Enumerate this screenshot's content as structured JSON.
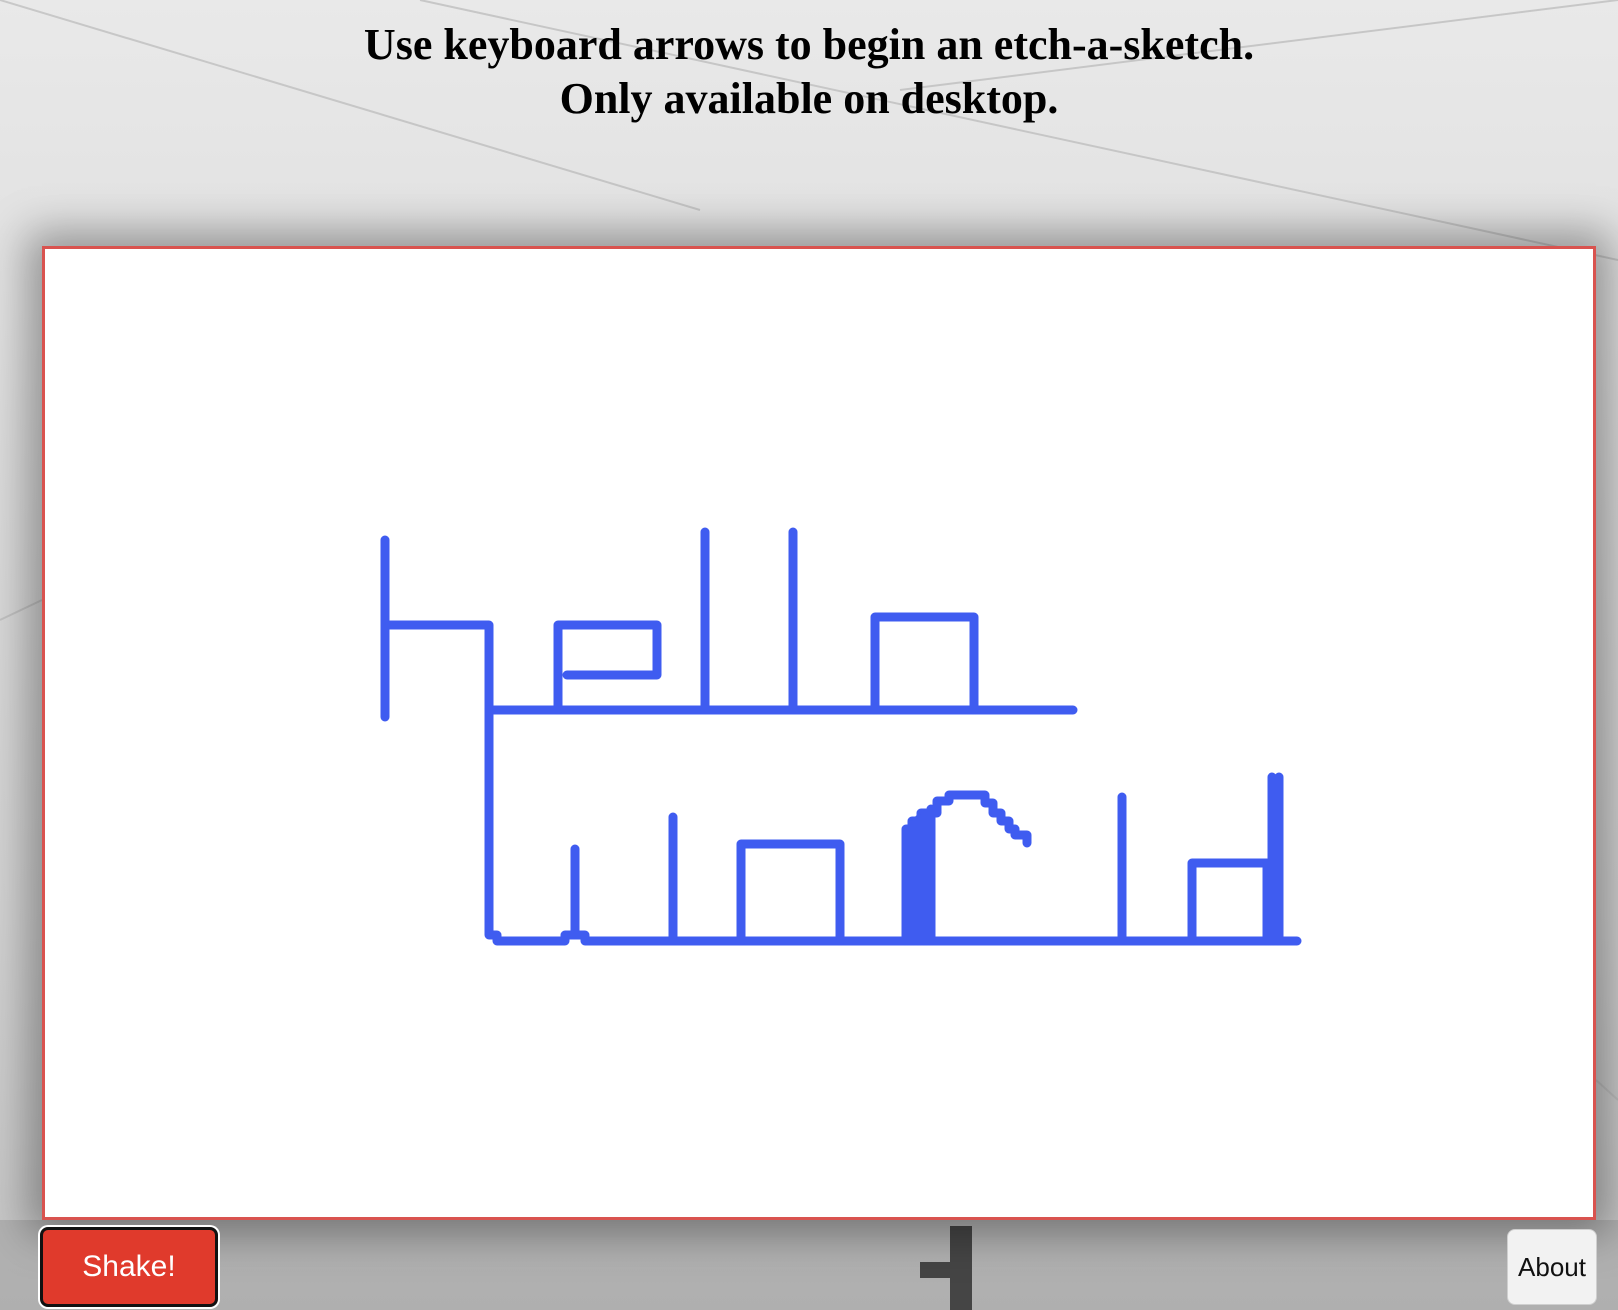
{
  "header": {
    "line1": "Use keyboard arrows to begin an etch-a-sketch.",
    "line2": "Only available on desktop."
  },
  "canvas": {
    "ink_color": "#3f5cf0",
    "border_color": "#d9534f",
    "drawing_text": "hello world"
  },
  "buttons": {
    "shake_label": "Shake!",
    "about_label": "About"
  },
  "colors": {
    "shake_bg": "#e03a2c",
    "about_bg": "#f2f2f2"
  }
}
